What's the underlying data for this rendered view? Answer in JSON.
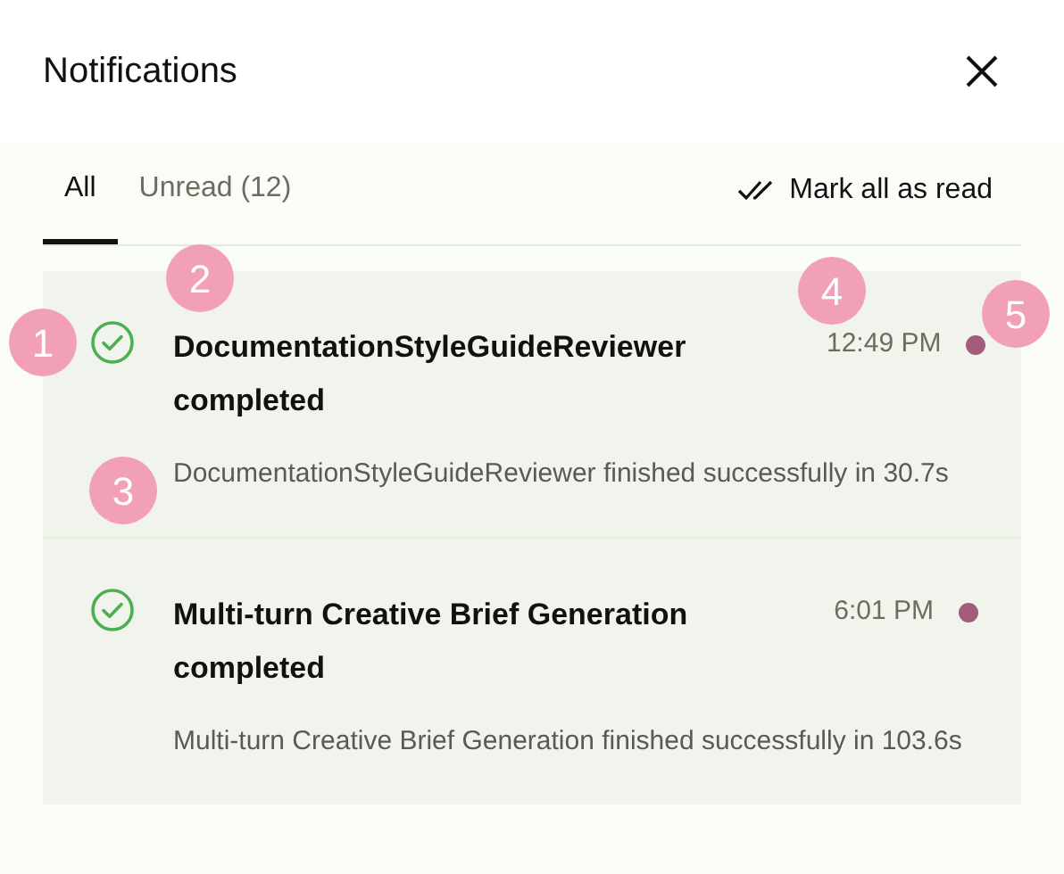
{
  "header": {
    "title": "Notifications"
  },
  "tabs": [
    {
      "label": "All",
      "selected": true
    },
    {
      "label": "Unread (12)",
      "selected": false
    }
  ],
  "mark_all": {
    "label": "Mark all as read"
  },
  "notifications": [
    {
      "title": "DocumentationStyleGuideReviewer completed",
      "time": "12:49 PM",
      "message": "DocumentationStyleGuideReviewer finished successfully in 30.7s",
      "unread": true
    },
    {
      "title": "Multi-turn Creative Brief Generation completed",
      "time": "6:01 PM",
      "message": "Multi-turn Creative Brief Generation finished successfully in 103.6s",
      "unread": true
    }
  ],
  "annotations": [
    {
      "label": "1"
    },
    {
      "label": "2"
    },
    {
      "label": "3"
    },
    {
      "label": "4"
    },
    {
      "label": "5"
    }
  ]
}
